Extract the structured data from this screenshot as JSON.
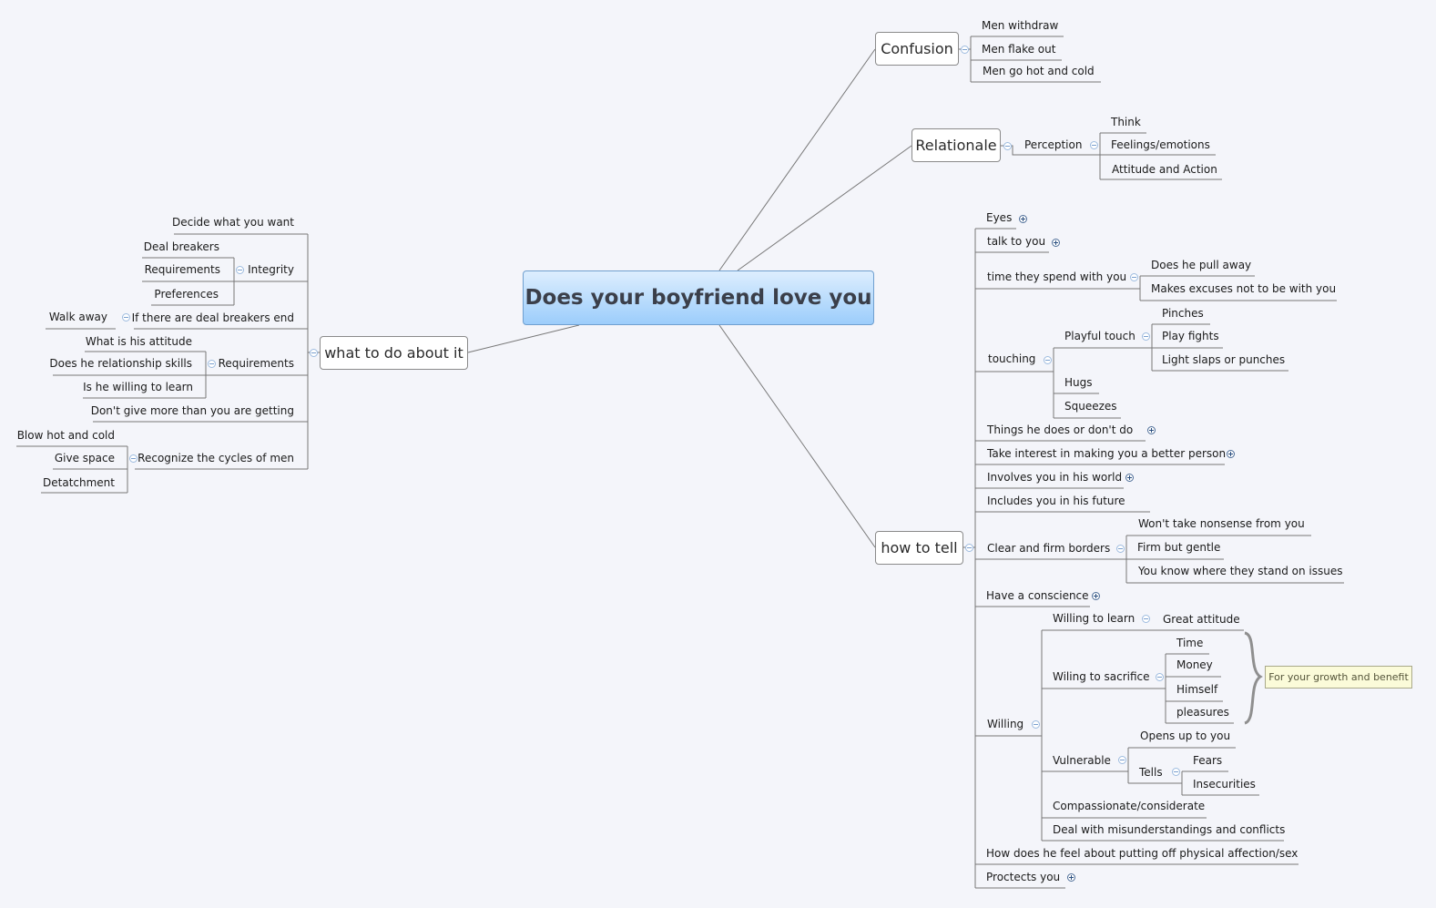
{
  "central": "Does your boyfriend love you",
  "main": {
    "confusion": "Confusion",
    "relationale": "Relationale",
    "how_to_tell": "how to tell",
    "what_to_do": "what to do about it"
  },
  "confusion": [
    "Men withdraw",
    "Men flake out",
    "Men go hot and cold"
  ],
  "relationale": {
    "perception": "Perception",
    "items": [
      "Think",
      "Feelings/emotions",
      "Attitude and Action"
    ]
  },
  "how_to_tell": {
    "eyes": "Eyes",
    "talk": "talk to you",
    "time": "time they spend with you",
    "time_items": [
      "Does he pull away",
      "Makes excuses not to be with you"
    ],
    "touching": "touching",
    "playful": "Playful touch",
    "playful_items": [
      "Pinches",
      "Play fights",
      "Light slaps or punches"
    ],
    "hugs": "Hugs",
    "squeezes": "Squeezes",
    "things": "Things  he does  or don't do",
    "interest": "Take interest in making you a better person",
    "involves": "Involves you in his world",
    "includes": "Includes you in his future",
    "borders": "Clear and firm borders",
    "border_items": [
      "Won't take nonsense from you",
      "Firm but gentle",
      "You know where they stand on issues"
    ],
    "conscience": "Have a conscience",
    "willing": "Willing",
    "willing_learn": "Willing to learn",
    "great_attitude": "Great attitude",
    "sacrifice": "Wiling to sacrifice",
    "sacrifice_items": [
      "Time",
      "Money",
      "Himself",
      "pleasures"
    ],
    "note": "For your growth and benefit",
    "vulnerable": "Vulnerable",
    "opens": "Opens up to you",
    "tells": "Tells",
    "tells_items": [
      "Fears",
      "Insecurities"
    ],
    "compassionate": "Compassionate/considerate",
    "deal": "Deal with misunderstandings and conflicts",
    "feel": "How does he feel about putting off physical affection/sex",
    "protects": "Proctects you"
  },
  "what_to_do": {
    "decide": "Decide what you want",
    "integrity": "Integrity",
    "integrity_items": [
      "Deal breakers",
      "Requirements",
      "Preferences"
    ],
    "deal_breakers_end": "If there are deal breakers end",
    "walk_away": "Walk away",
    "requirements": "Requirements",
    "requirement_items": [
      "What is his attitude",
      "Does he relationship skills",
      "Is he willing to learn"
    ],
    "dont_give": "Don't give more than you are getting",
    "recognize": "Recognize the cycles of men",
    "cycle_items": [
      "Blow hot and cold",
      "Give space",
      "Detatchment"
    ]
  }
}
